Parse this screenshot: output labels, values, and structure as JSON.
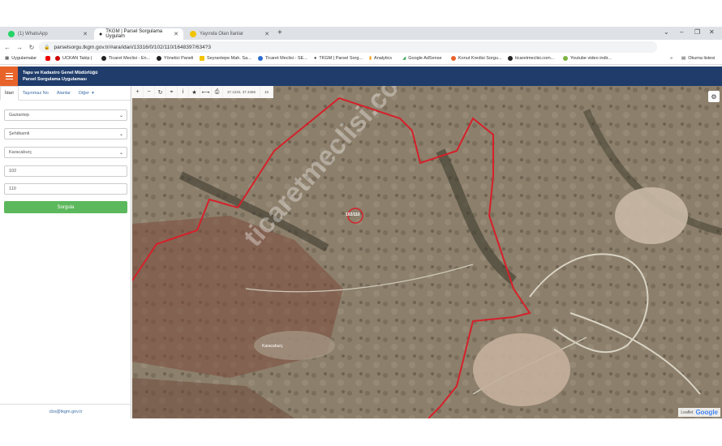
{
  "browser": {
    "tabs": [
      {
        "label": "(1) WhatsApp",
        "icon": "whatsapp-icon"
      },
      {
        "label": "TKGM | Parsel Sorgulama Uygulam",
        "icon": "location-pin-icon"
      },
      {
        "label": "Yayında Olan İlanlar",
        "icon": "s-brand-icon"
      }
    ],
    "url": "parselsorgu.tkgm.gov.tr/#ara/idari/13316/0/102/110/1648397/634?3",
    "bookmarks": [
      {
        "label": "Uygulamalar"
      },
      {
        "label": ""
      },
      {
        "label": "UCKAN Takip |"
      },
      {
        "label": "Ticaret Meclisi - En..."
      },
      {
        "label": "Yönetici Paneli"
      },
      {
        "label": "Seyrantepe Mah. Sa..."
      },
      {
        "label": "Ticaret Meclisi - SE..."
      },
      {
        "label": "TKGM | Parsel Sorg..."
      },
      {
        "label": "Analytics"
      },
      {
        "label": "Google AdSense"
      },
      {
        "label": "Konut Kredisi Sorgu..."
      },
      {
        "label": "ticaretmeclisi.com..."
      },
      {
        "label": "Youtube video indir..."
      },
      {
        "label": "Okuma listesi"
      }
    ]
  },
  "app": {
    "title_line1": "Tapu ve Kadastro Genel Müdürlüğü",
    "title_line2": "Parsel Sorgulama Uygulaması"
  },
  "sidebar": {
    "tabs": [
      "İdari",
      "Taşınmaz No",
      "Alanlar",
      "Diğer"
    ],
    "province": "Gaziantep",
    "district": "Şehitkamil",
    "neighborhood": "Karacaburç",
    "block": "102",
    "parcel": "110",
    "query_label": "Sorgula",
    "footer_email": "cbs@tkgm.gov.tr"
  },
  "map": {
    "coord1": "37.1234, 37.3456",
    "coord2": "16",
    "parcel_label": "102/110",
    "place_label": "Karacaburç",
    "attribution": "Leaflet",
    "google": "Google",
    "watermark": "ticaretmeclisi.com"
  }
}
